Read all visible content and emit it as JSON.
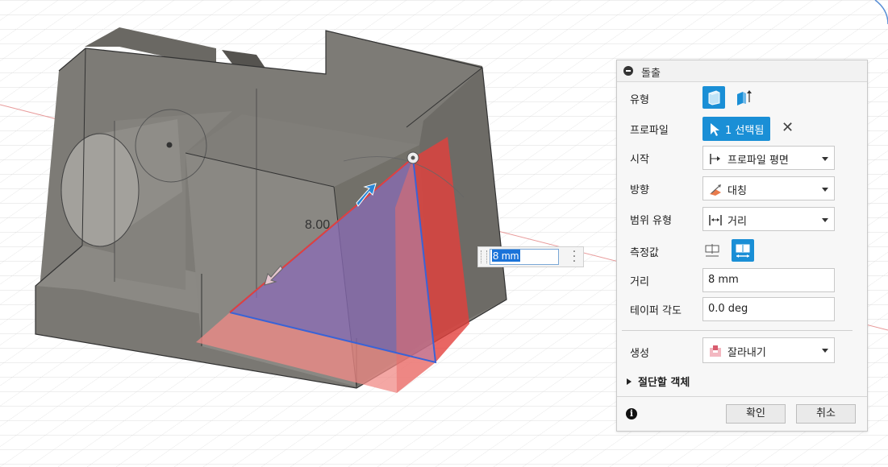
{
  "viewport": {
    "dimension_label": "8.00",
    "distance_input_value": "8 mm"
  },
  "panel": {
    "title": "돌출",
    "rows": {
      "type_label": "유형",
      "profile_label": "프로파일",
      "profile_select_text": "1 선택됨",
      "start_label": "시작",
      "start_value": "프로파일 평면",
      "direction_label": "방향",
      "direction_value": "대칭",
      "extent_label": "범위 유형",
      "extent_value": "거리",
      "measure_label": "측정값",
      "distance_label": "거리",
      "distance_value": "8 mm",
      "taper_label": "테이퍼 각도",
      "taper_value": "0.0 deg",
      "operation_label": "생성",
      "operation_value": "잘라내기"
    },
    "section_objects_to_cut": "절단할 객체",
    "footer": {
      "ok_label": "확인",
      "cancel_label": "취소"
    }
  },
  "colors": {
    "accent": "#1a8fd6",
    "body_gray": "#6f6d68",
    "profile_red": "#e3403c",
    "profile_blue": "#3a63d6"
  }
}
